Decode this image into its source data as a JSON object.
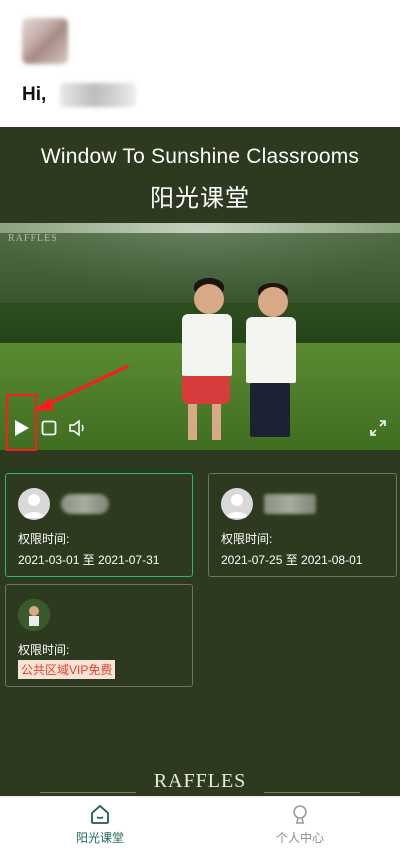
{
  "greeting": {
    "hi": "Hi,"
  },
  "title": {
    "en": "Window To Sunshine Classrooms",
    "cn": "阳光课堂"
  },
  "video": {
    "watermark": "RAFFLES",
    "controls": [
      "play-icon",
      "stop-icon",
      "volume-icon",
      "fullscreen-icon"
    ]
  },
  "cards": [
    {
      "label": "权限时间:",
      "value": "2021-03-01 至 2021-07-31"
    },
    {
      "label": "权限时间:",
      "value": "2021-07-25 至 2021-08-01"
    },
    {
      "label": "权限时间:",
      "value": "公共区域VIP免费"
    }
  ],
  "footer": {
    "logo": "RAFFLES"
  },
  "tabs": [
    {
      "label": "阳光课堂",
      "icon": "home-icon",
      "active": true
    },
    {
      "label": "个人中心",
      "icon": "profile-icon",
      "active": false
    }
  ],
  "colors": {
    "bg": "#2d3a1f",
    "accent": "#1f6b5d",
    "active_border": "#2fb183",
    "vip_text": "#e8432a",
    "highlight": "#ff1b1b"
  }
}
